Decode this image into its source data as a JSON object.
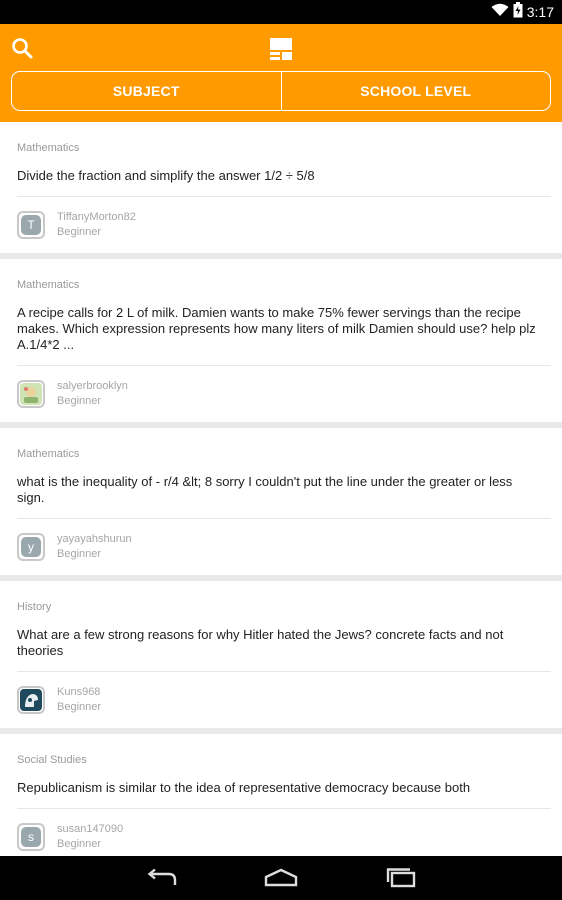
{
  "status_bar": {
    "time": "3:17",
    "icons": [
      "wifi-icon",
      "battery-icon"
    ]
  },
  "header": {
    "search_icon": "search-icon",
    "logo_icon": "app-logo-icon",
    "filters": [
      {
        "label": "SUBJECT"
      },
      {
        "label": "SCHOOL LEVEL"
      }
    ]
  },
  "colors": {
    "accent": "#ff9a00",
    "background": "#e9e9e9",
    "card": "#ffffff",
    "muted_text": "#9a9a9a"
  },
  "feed": [
    {
      "subject": "Mathematics",
      "question": "Divide the fraction and simplify the answer 1/2 ÷ 5/8",
      "author": "TiffanyMorton82",
      "level": "Beginner",
      "avatar": {
        "type": "letter",
        "letter": "T"
      }
    },
    {
      "subject": "Mathematics",
      "question": "A recipe calls for 2 L of milk. Damien wants to make 75% fewer servings than the recipe makes.   Which expression represents how many liters of milk Damien should use? help plz A.1/4*2   ...",
      "author": "salyerbrooklyn",
      "level": "Beginner",
      "avatar": {
        "type": "image"
      }
    },
    {
      "subject": "Mathematics",
      "question": "what is the inequality of - r/4 &lt; 8 sorry I couldn't put the line under the greater or less sign.",
      "author": "yayayahshurun",
      "level": "Beginner",
      "avatar": {
        "type": "letter",
        "letter": "y"
      }
    },
    {
      "subject": "History",
      "question": "What are a few strong reasons for why Hitler hated the Jews? concrete facts and not theories",
      "author": "Kuns968",
      "level": "Beginner",
      "avatar": {
        "type": "image"
      }
    },
    {
      "subject": "Social Studies",
      "question": "Republicanism is similar to the idea of representative democracy because both",
      "author": "susan147090",
      "level": "Beginner",
      "avatar": {
        "type": "letter",
        "letter": "s"
      }
    }
  ],
  "nav_bar": {
    "buttons": [
      "back-icon",
      "home-icon",
      "recents-icon"
    ]
  }
}
